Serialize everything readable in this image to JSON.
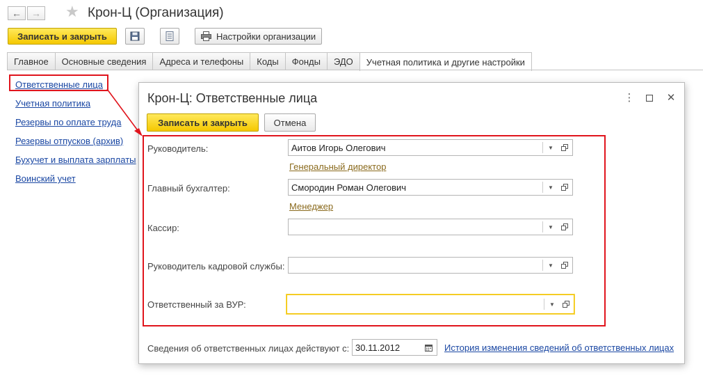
{
  "window": {
    "title": "Крон-Ц (Организация)"
  },
  "toolbar": {
    "save_close": "Записать и закрыть",
    "settings": "Настройки организации"
  },
  "tabs": [
    {
      "label": "Главное"
    },
    {
      "label": "Основные сведения"
    },
    {
      "label": "Адреса и телефоны"
    },
    {
      "label": "Коды"
    },
    {
      "label": "Фонды"
    },
    {
      "label": "ЭДО"
    },
    {
      "label": "Учетная политика и другие настройки"
    }
  ],
  "sidebar": {
    "links": [
      {
        "label": "Ответственные лица"
      },
      {
        "label": "Учетная политика"
      },
      {
        "label": "Резервы по оплате труда"
      },
      {
        "label": "Резервы отпусков (архив)"
      },
      {
        "label": "Бухучет и выплата зарплаты"
      },
      {
        "label": "Воинский учет"
      }
    ]
  },
  "dialog": {
    "title": "Крон-Ц: Ответственные лица",
    "save_close": "Записать и закрыть",
    "cancel": "Отмена",
    "fields": [
      {
        "label": "Руководитель:",
        "value": "Аитов Игорь Олегович",
        "sublink": "Генеральный директор"
      },
      {
        "label": "Главный бухгалтер:",
        "value": "Смородин Роман Олегович",
        "sublink": "Менеджер"
      },
      {
        "label": "Кассир:",
        "value": ""
      },
      {
        "label": "Руководитель кадровой службы:",
        "value": ""
      },
      {
        "label": "Ответственный за ВУР:",
        "value": ""
      }
    ],
    "effective_label": "Сведения об ответственных лицах действуют с:",
    "effective_date": "30.11.2012",
    "history_link": "История изменения сведений об ответственных лицах"
  },
  "colors": {
    "accent_yellow": "#f5c800",
    "highlight_red": "#e0141c",
    "link_blue": "#1a47a3",
    "sublink_brown": "#8a6a1d"
  }
}
